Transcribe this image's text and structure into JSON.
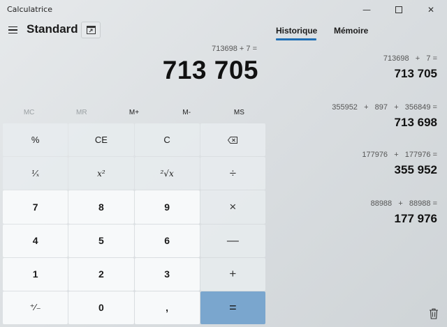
{
  "window": {
    "title": "Calculatrice",
    "minimize_glyph": "—",
    "close_glyph": "✕"
  },
  "header": {
    "mode": "Standard",
    "keep_on_top_icon": "keep-on-top-icon",
    "menu_icon": "hamburger-icon"
  },
  "display": {
    "expression": "713698 + 7 =",
    "result": "713 705"
  },
  "memory": {
    "mc": "MC",
    "mr": "MR",
    "mplus": "M+",
    "mminus": "M-",
    "ms": "MS"
  },
  "keys": {
    "percent": "%",
    "ce": "CE",
    "c": "C",
    "backspace_icon": "backspace-icon",
    "reciprocal": "¹⁄ₓ",
    "square": "x²",
    "sqrt": "²√x",
    "divide": "÷",
    "seven": "7",
    "eight": "8",
    "nine": "9",
    "multiply": "×",
    "four": "4",
    "five": "5",
    "six": "6",
    "minus": "—",
    "one": "1",
    "two": "2",
    "three": "3",
    "plus": "+",
    "negate": "⁺⁄₋",
    "zero": "0",
    "decimal": ",",
    "equals": "="
  },
  "panel": {
    "tab_history": "Historique",
    "tab_memory": "Mémoire",
    "history": [
      {
        "expression": "713698   +   7 =",
        "result": "713 705"
      },
      {
        "expression": "355952   +   897   +   356849 =",
        "result": "713 698"
      },
      {
        "expression": "177976   +   177976 =",
        "result": "355 952"
      },
      {
        "expression": "88988   +   88988 =",
        "result": "177 976"
      }
    ],
    "trash_icon": "trash-icon"
  },
  "colors": {
    "accent": "#1f6fb5",
    "equals_key": "#7aa6ce",
    "number_key": "#f7f9fa"
  }
}
